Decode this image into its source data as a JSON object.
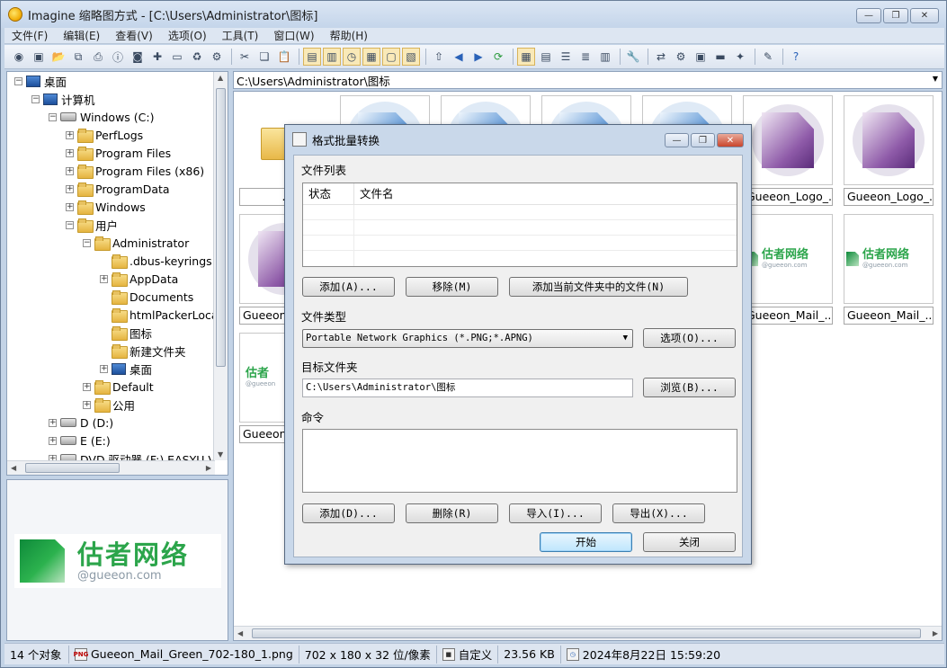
{
  "window": {
    "title": "Imagine 缩略图方式 - [C:\\Users\\Administrator\\图标]",
    "buttons": {
      "minimize": "▭",
      "maximize": "▣",
      "close": "✕"
    }
  },
  "menu": [
    "文件(F)",
    "编辑(E)",
    "查看(V)",
    "选项(O)",
    "工具(T)",
    "窗口(W)",
    "帮助(H)"
  ],
  "toolbar_icons": [
    "eye-icon",
    "slideshow-icon",
    "open-folder-icon",
    "copy-file-icon",
    "print-icon",
    "info-icon",
    "camera-icon",
    "new-folder-icon",
    "rename-icon",
    "recycle-icon",
    "options-icon",
    "cut-icon",
    "copy-icon",
    "paste-icon",
    "view-thumbs-icon",
    "view-filmstrip-icon",
    "clock-icon",
    "view-grid-icon",
    "view-page-icon",
    "view-image-icon",
    "up-folder-icon",
    "back-icon",
    "forward-icon",
    "refresh-icon",
    "thumbs-icon",
    "list-large-icon",
    "list-small-icon",
    "details-icon",
    "table-icon",
    "tools-icon",
    "convert-icon",
    "batch-icon",
    "capture-icon",
    "film-icon",
    "plugin-icon",
    "edit-icon",
    "help-icon"
  ],
  "tree": {
    "desktop": "桌面",
    "computer": "计算机",
    "drive_c": "Windows (C:)",
    "folders_c": [
      "PerfLogs",
      "Program Files",
      "Program Files (x86)",
      "ProgramData",
      "Windows",
      "用户"
    ],
    "admin": "Administrator",
    "admin_children": [
      ".dbus-keyrings",
      "AppData",
      "Documents",
      "htmlPackerLocal",
      "图标",
      "新建文件夹",
      "桌面"
    ],
    "default": "Default",
    "public": "公用",
    "drive_d": "D (D:)",
    "drive_e": "E (E:)",
    "drive_f": "DVD 驱动器 (F:) EASYU V"
  },
  "preview": {
    "logo_cn": "估者网络",
    "logo_en": "@gueeon.com"
  },
  "address": "C:\\Users\\Administrator\\图标",
  "thumbnails": {
    "folder_caption": "..",
    "logo_1": "Gueeon_Logo_...",
    "logo_2": "Gueeon_Logo_...",
    "row2_first": "Gueeon_",
    "mail_1": "Gueeon_Mail_...",
    "mail_2": "Gueeon_Mail_...",
    "row3_first": "Gueeon",
    "mini_cn": "估者网络",
    "mini_en": "@gueeon.com",
    "mini_cn_short": "估者",
    "mini_en_short": "@gueeon"
  },
  "status": {
    "count": "14 个对象",
    "filename": "Gueeon_Mail_Green_702-180_1.png",
    "dims": "702 x 180 x 32 位/像素",
    "custom": "自定义",
    "size": "23.56 KB",
    "date": "2024年8月22日 15:59:20",
    "png_badge": "PNG"
  },
  "dialog": {
    "title": "格式批量转换",
    "file_list_label": "文件列表",
    "col_status": "状态",
    "col_filename": "文件名",
    "btn_add": "添加(A)...",
    "btn_remove": "移除(M)",
    "btn_add_current": "添加当前文件夹中的文件(N)",
    "file_type_label": "文件类型",
    "file_type_value": "Portable Network Graphics (*.PNG;*.APNG)",
    "btn_options": "选项(O)...",
    "target_label": "目标文件夹",
    "target_value": "C:\\Users\\Administrator\\图标",
    "btn_browse": "浏览(B)...",
    "command_label": "命令",
    "btn_cmd_add": "添加(D)...",
    "btn_cmd_delete": "删除(R)",
    "btn_import": "导入(I)...",
    "btn_export": "导出(X)...",
    "btn_start": "开始",
    "btn_close": "关闭"
  }
}
